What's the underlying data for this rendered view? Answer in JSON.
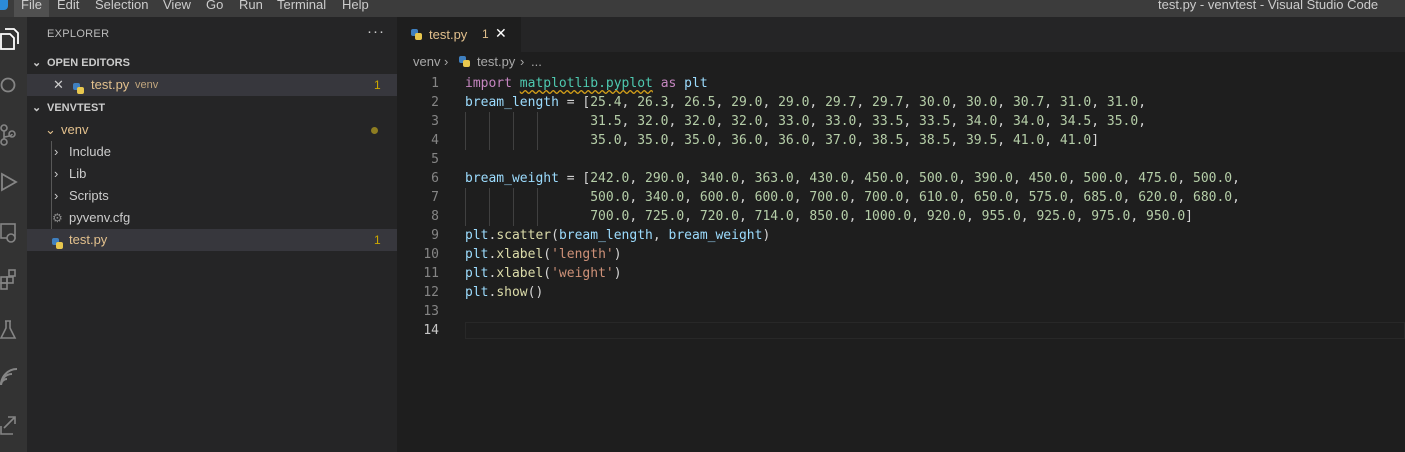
{
  "window": {
    "title": "test.py - venvtest - Visual Studio Code",
    "menu": [
      "File",
      "Edit",
      "Selection",
      "View",
      "Go",
      "Run",
      "Terminal",
      "Help"
    ]
  },
  "activity_bar": {
    "icons": [
      "explorer-icon",
      "search-icon",
      "source-control-icon",
      "run-debug-icon",
      "remote-explorer-icon",
      "extensions-icon",
      "testing-icon",
      "live-share-icon",
      "share-icon"
    ]
  },
  "sidebar": {
    "title": "EXPLORER",
    "more": "···",
    "open_editors": {
      "header": "OPEN EDITORS",
      "items": [
        {
          "close": "✕",
          "name": "test.py",
          "folder": "venv",
          "problems": "1"
        }
      ]
    },
    "workspace": {
      "header": "VENVTEST",
      "tree": [
        {
          "label": "venv",
          "chevron": "⌄",
          "modified_dot": true
        },
        {
          "label": "Include",
          "chevron": "›"
        },
        {
          "label": "Lib",
          "chevron": "›"
        },
        {
          "label": "Scripts",
          "chevron": "›"
        },
        {
          "label": "pyvenv.cfg",
          "icon": "gear-icon"
        },
        {
          "label": "test.py",
          "icon": "python-icon",
          "problems": "1"
        }
      ]
    }
  },
  "editor": {
    "tab": {
      "label": "test.py",
      "problems": "1",
      "close": "✕"
    },
    "breadcrumb": [
      "venv",
      "›",
      "test.py",
      "›",
      "..."
    ],
    "current_line": 14,
    "lines": [
      "import matplotlib.pyplot as plt",
      "bream_length = [25.4, 26.3, 26.5, 29.0, 29.0, 29.7, 29.7, 30.0, 30.0, 30.7, 31.0, 31.0,",
      "                31.5, 32.0, 32.0, 32.0, 33.0, 33.0, 33.5, 33.5, 34.0, 34.0, 34.5, 35.0,",
      "                35.0, 35.0, 35.0, 36.0, 36.0, 37.0, 38.5, 38.5, 39.5, 41.0, 41.0]",
      "",
      "bream_weight = [242.0, 290.0, 340.0, 363.0, 430.0, 450.0, 500.0, 390.0, 450.0, 500.0, 475.0, 500.0,",
      "                500.0, 340.0, 600.0, 600.0, 700.0, 700.0, 610.0, 650.0, 575.0, 685.0, 620.0, 680.0,",
      "                700.0, 725.0, 720.0, 714.0, 850.0, 1000.0, 920.0, 955.0, 925.0, 975.0, 950.0]",
      "plt.scatter(bream_length, bream_weight)",
      "plt.xlabel('length')",
      "plt.xlabel('weight')",
      "plt.show()",
      "",
      ""
    ]
  }
}
